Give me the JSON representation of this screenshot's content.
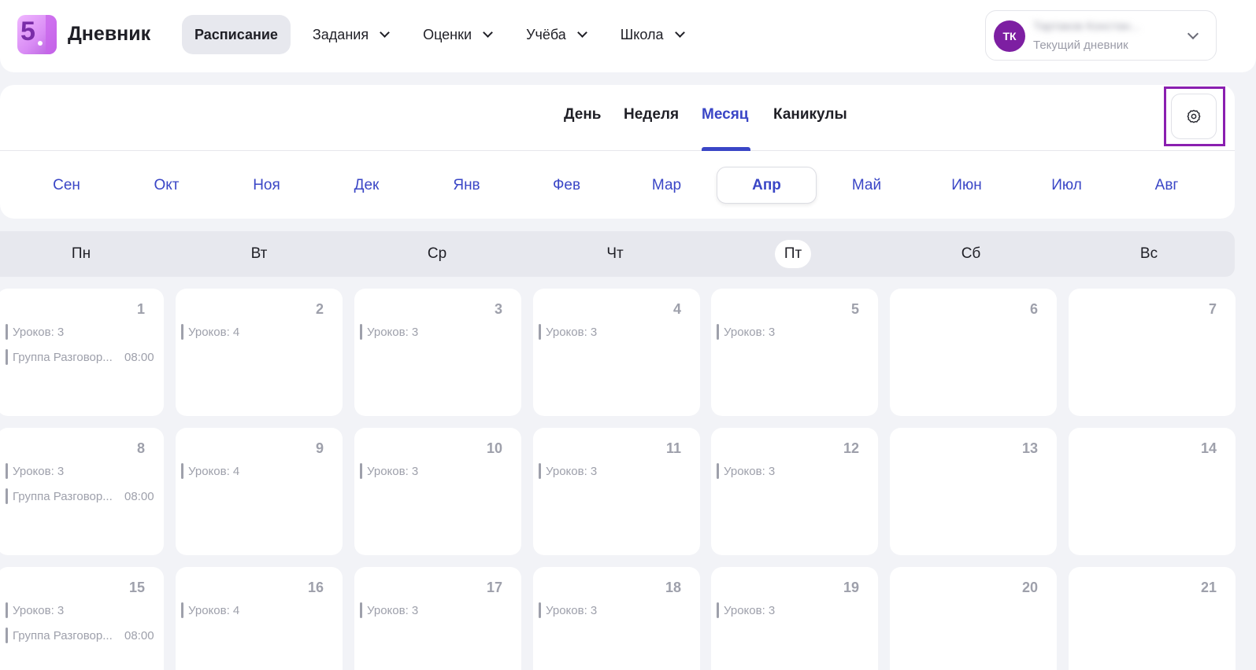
{
  "header": {
    "logo_text": "5",
    "brand": "Дневник",
    "nav": [
      {
        "label": "Расписание",
        "active": true,
        "dropdown": false
      },
      {
        "label": "Задания",
        "active": false,
        "dropdown": true
      },
      {
        "label": "Оценки",
        "active": false,
        "dropdown": true
      },
      {
        "label": "Учёба",
        "active": false,
        "dropdown": true
      },
      {
        "label": "Школа",
        "active": false,
        "dropdown": true
      }
    ],
    "profile": {
      "initials": "ТК",
      "name": "Тартаков Констан...",
      "subtitle": "Текущий дневник"
    }
  },
  "view_tabs": {
    "items": [
      "День",
      "Неделя",
      "Месяц",
      "Каникулы"
    ],
    "active": "Месяц"
  },
  "months": {
    "items": [
      "Сен",
      "Окт",
      "Ноя",
      "Дек",
      "Янв",
      "Фев",
      "Мар",
      "Апр",
      "Май",
      "Июн",
      "Июл",
      "Авг"
    ],
    "active": "Апр"
  },
  "weekdays": {
    "items": [
      "Пн",
      "Вт",
      "Ср",
      "Чт",
      "Пт",
      "Сб",
      "Вс"
    ],
    "today": "Пт"
  },
  "calendar": {
    "weeks": [
      [
        {
          "day": "1",
          "entries": [
            {
              "text": "Уроков: 3"
            },
            {
              "text": "Группа Разговор...",
              "time": "08:00"
            }
          ]
        },
        {
          "day": "2",
          "entries": [
            {
              "text": "Уроков: 4"
            }
          ]
        },
        {
          "day": "3",
          "entries": [
            {
              "text": "Уроков: 3"
            }
          ]
        },
        {
          "day": "4",
          "entries": [
            {
              "text": "Уроков: 3"
            }
          ]
        },
        {
          "day": "5",
          "entries": [
            {
              "text": "Уроков: 3"
            }
          ]
        },
        {
          "day": "6",
          "entries": []
        },
        {
          "day": "7",
          "entries": []
        }
      ],
      [
        {
          "day": "8",
          "entries": [
            {
              "text": "Уроков: 3"
            },
            {
              "text": "Группа Разговор...",
              "time": "08:00"
            }
          ]
        },
        {
          "day": "9",
          "entries": [
            {
              "text": "Уроков: 4"
            }
          ]
        },
        {
          "day": "10",
          "entries": [
            {
              "text": "Уроков: 3"
            }
          ]
        },
        {
          "day": "11",
          "entries": [
            {
              "text": "Уроков: 3"
            }
          ]
        },
        {
          "day": "12",
          "entries": [
            {
              "text": "Уроков: 3"
            }
          ]
        },
        {
          "day": "13",
          "entries": []
        },
        {
          "day": "14",
          "entries": []
        }
      ],
      [
        {
          "day": "15",
          "entries": [
            {
              "text": "Уроков: 3"
            },
            {
              "text": "Группа Разговор...",
              "time": "08:00"
            }
          ]
        },
        {
          "day": "16",
          "entries": [
            {
              "text": "Уроков: 4"
            }
          ]
        },
        {
          "day": "17",
          "entries": [
            {
              "text": "Уроков: 3"
            }
          ]
        },
        {
          "day": "18",
          "entries": [
            {
              "text": "Уроков: 3"
            }
          ]
        },
        {
          "day": "19",
          "entries": [
            {
              "text": "Уроков: 3"
            }
          ]
        },
        {
          "day": "20",
          "entries": []
        },
        {
          "day": "21",
          "entries": []
        }
      ]
    ]
  },
  "colors": {
    "accent": "#3a46c6",
    "avatar": "#7d1fa2",
    "highlight": "#8a1fb0"
  },
  "icons": {
    "settings": "gear-icon",
    "dropdown": "chevron-down-icon"
  }
}
